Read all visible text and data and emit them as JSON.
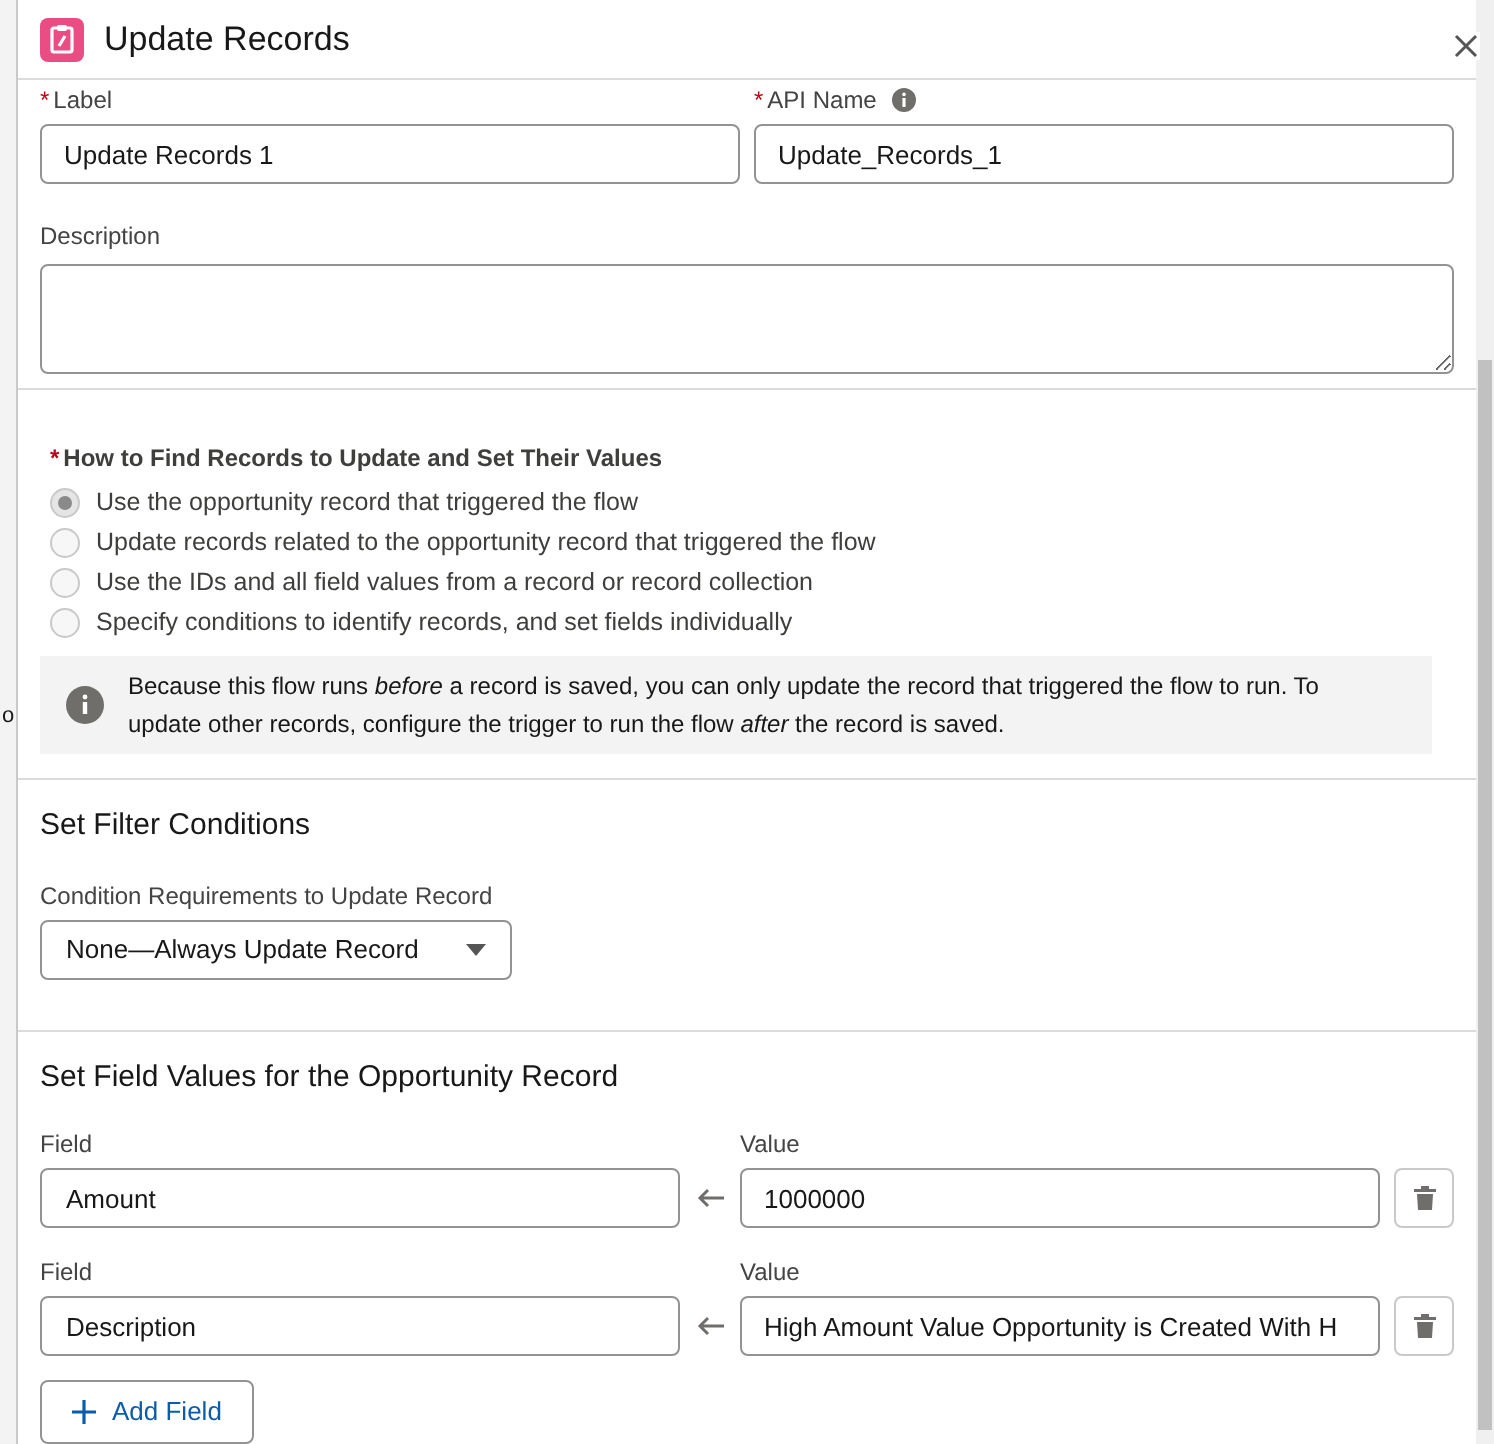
{
  "background_fragment": "o",
  "modal": {
    "title": "Update Records"
  },
  "label_field": {
    "required_mark": "*",
    "label": "Label",
    "value": "Update Records 1"
  },
  "api_name_field": {
    "required_mark": "*",
    "label": "API Name",
    "value": "Update_Records_1"
  },
  "description_field": {
    "label": "Description"
  },
  "find_records": {
    "required_mark": "*",
    "heading": "How to Find Records to Update and Set Their Values",
    "options": [
      {
        "label": "Use the opportunity record that triggered the flow",
        "selected": true
      },
      {
        "label": "Update records related to the opportunity record that triggered the flow",
        "selected": false
      },
      {
        "label": "Use the IDs and all field values from a record or record collection",
        "selected": false
      },
      {
        "label": "Specify conditions to identify records, and set fields individually",
        "selected": false
      }
    ],
    "info": "Because this flow runs *before* a record is saved, you can only update the record that triggered the flow to run. To update other records, configure the trigger to run the flow *after* the record is saved."
  },
  "filter_conditions": {
    "heading": "Set Filter Conditions",
    "label": "Condition Requirements to Update Record",
    "value": "None—Always Update Record"
  },
  "field_values": {
    "heading": "Set Field Values for the Opportunity Record",
    "rows": [
      {
        "field_label": "Field",
        "field": "Amount",
        "value_label": "Value",
        "value": "1000000"
      },
      {
        "field_label": "Field",
        "field": "Description",
        "value_label": "Value",
        "value": "High Amount Value Opportunity is Created With H"
      }
    ],
    "add_button": "Add Field"
  }
}
